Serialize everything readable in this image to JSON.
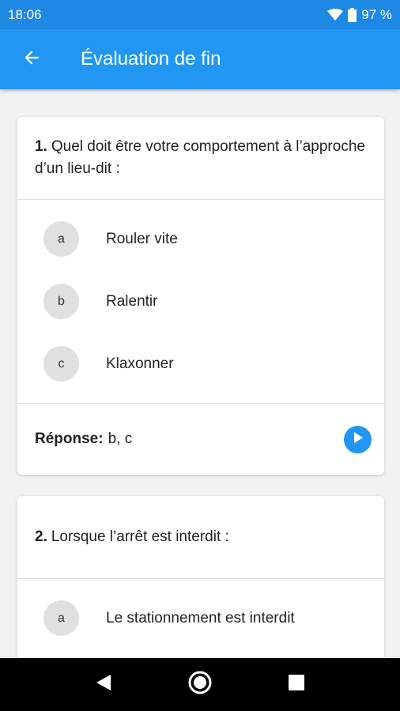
{
  "status": {
    "time": "18:06",
    "battery": "97 %",
    "wifi_icon": "wifi-icon",
    "battery_icon": "battery-icon"
  },
  "appbar": {
    "title": "Évaluation de fin",
    "back_icon": "arrow-back-icon"
  },
  "questions": [
    {
      "number": "1.",
      "text": "Quel doit être votre comportement à l’approche d’un lieu-dit :",
      "options": [
        {
          "letter": "a",
          "text": "Rouler vite"
        },
        {
          "letter": "b",
          "text": "Ralentir"
        },
        {
          "letter": "c",
          "text": "Klaxonner"
        }
      ],
      "answer_label": "Réponse:",
      "answer_value": "b, c"
    },
    {
      "number": "2.",
      "text": "Lorsque l’arrêt est interdit :",
      "options": [
        {
          "letter": "a",
          "text": "Le stationnement est interdit"
        }
      ]
    }
  ],
  "colors": {
    "primary": "#2196f3",
    "statusbar": "#1e88e5"
  }
}
